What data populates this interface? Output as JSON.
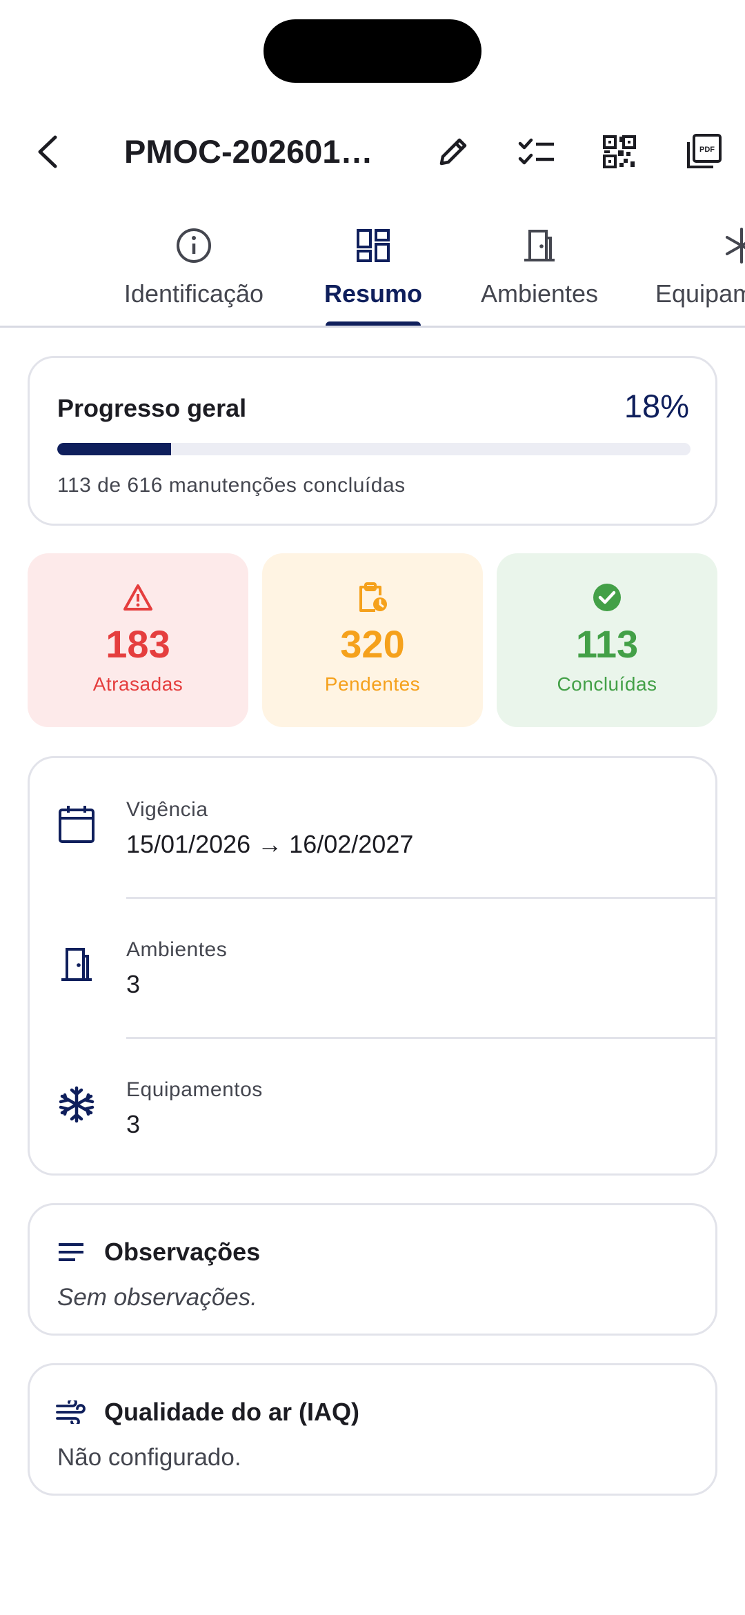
{
  "header": {
    "title": "PMOC-202601…",
    "actions": [
      "back-arrow-icon",
      "pencil-icon",
      "checklist-icon",
      "qr-code-icon",
      "pdf-icon"
    ]
  },
  "tabs": [
    {
      "label": "Identificação",
      "icon": "info-icon"
    },
    {
      "label": "Resumo",
      "icon": "dashboard-icon",
      "active": true
    },
    {
      "label": "Ambientes",
      "icon": "door-icon"
    },
    {
      "label": "Equipam",
      "icon": "snowflake-icon"
    }
  ],
  "progress": {
    "title": "Progresso geral",
    "percent_label": "18%",
    "fraction": 0.18,
    "subtitle": "113 de 616 manutenções concluídas"
  },
  "stats": {
    "late": {
      "value": "183",
      "label": "Atrasadas",
      "icon": "warning-icon",
      "color": "#e53e3e"
    },
    "pending": {
      "value": "320",
      "label": "Pendentes",
      "icon": "clipboard-clock-icon",
      "color": "#f5a11c"
    },
    "done": {
      "value": "113",
      "label": "Concluídas",
      "icon": "check-circle-icon",
      "color": "#43a047"
    }
  },
  "info": [
    {
      "label": "Vigência",
      "value": "15/01/2026 → 16/02/2027",
      "icon": "calendar-icon"
    },
    {
      "label": "Ambientes",
      "value": "3",
      "icon": "door-icon"
    },
    {
      "label": "Equipamentos",
      "value": "3",
      "icon": "snowflake-icon"
    }
  ],
  "observations": {
    "title": "Observações",
    "body": "Sem observações.",
    "icon": "notes-icon"
  },
  "air_quality": {
    "title": "Qualidade do ar (IAQ)",
    "body": "Não configurado.",
    "icon": "wind-icon"
  },
  "colors": {
    "primary": "#0f1f5c",
    "text": "#1c1c22",
    "muted": "#44464f",
    "border": "#e2e3ea"
  }
}
